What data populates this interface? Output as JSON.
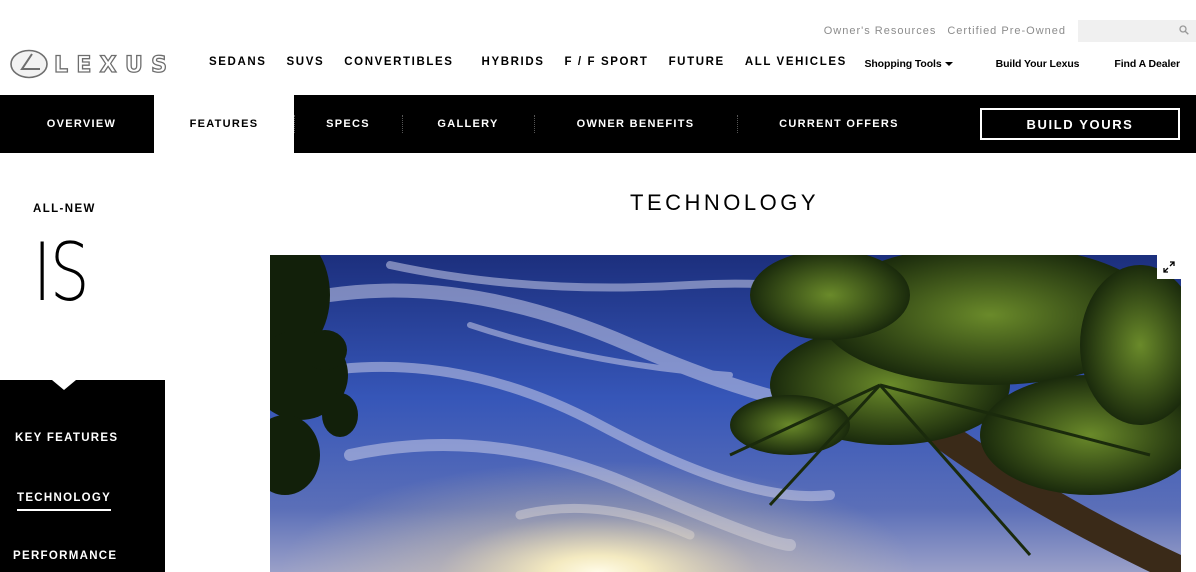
{
  "utility": {
    "owners_resources": "Owner's Resources",
    "certified_pre_owned": "Certified Pre-Owned",
    "search_placeholder": ""
  },
  "brand": {
    "logo_text": "LEXUS"
  },
  "main_nav": [
    "SEDANS",
    "SUVS",
    "CONVERTIBLES",
    "HYBRIDS",
    "F / F SPORT",
    "FUTURE",
    "ALL VEHICLES"
  ],
  "right_links": {
    "shopping_tools": "Shopping Tools",
    "build_your_lexus": "Build Your Lexus",
    "find_a_dealer": "Find A Dealer"
  },
  "model_nav": {
    "tabs": [
      "OVERVIEW",
      "FEATURES",
      "SPECS",
      "GALLERY",
      "OWNER BENEFITS",
      "CURRENT OFFERS"
    ],
    "active": "FEATURES",
    "build_button": "BUILD YOURS"
  },
  "model": {
    "eyebrow": "ALL-NEW",
    "name": "IS"
  },
  "side_menu": {
    "items": [
      "KEY FEATURES",
      "TECHNOLOGY",
      "PERFORMANCE"
    ],
    "current": "TECHNOLOGY"
  },
  "content": {
    "section_title": "TECHNOLOGY"
  },
  "colors": {
    "nav_bar": "#000000",
    "accent_text": "#8c8c8c",
    "search_bg": "#f0f0f0"
  },
  "icons": {
    "search": "search-icon",
    "expand": "expand-icon",
    "dropdown": "caret-down-icon"
  }
}
